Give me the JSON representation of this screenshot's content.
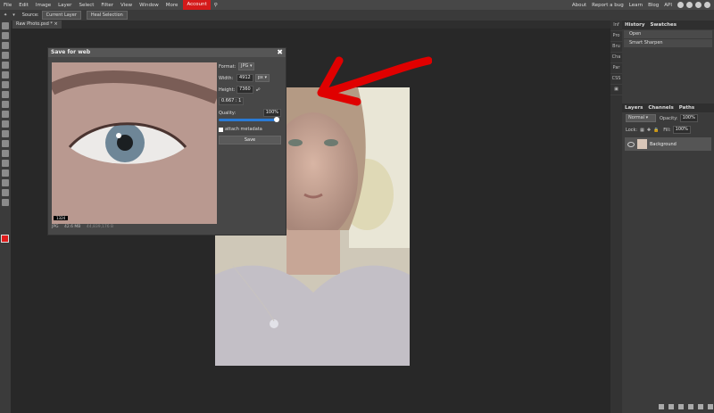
{
  "menubar": {
    "items": [
      "File",
      "Edit",
      "Image",
      "Layer",
      "Select",
      "Filter",
      "View",
      "Window",
      "More"
    ],
    "accent_item": "Account",
    "right_items": [
      "About",
      "Report a bug",
      "Learn",
      "Blog",
      "API"
    ],
    "accent_color": "#d41a1a"
  },
  "options_bar": {
    "source_label": "Source:",
    "source_value": "Current Layer",
    "heal_button": "Heal Selection"
  },
  "tab": {
    "label": "Raw Photo.psd *"
  },
  "dialog": {
    "title": "Save for web",
    "format_label": "Format:",
    "format_value": "JPG",
    "width_label": "Width:",
    "width_value": "4912",
    "unit_value": "px",
    "height_label": "Height:",
    "height_value": "7360",
    "ratio_value": "0.667 : 1",
    "quality_label": "Quality:",
    "quality_value": "100%",
    "quality_level": 1.0,
    "metadata_label": "attach metadata",
    "save_button": "Save",
    "zoom_badge": "1324",
    "footer_format": "JPG",
    "footer_size": "42.6 MB",
    "footer_extra": "44,839,176 B"
  },
  "right_column": {
    "items": [
      "Inf",
      "Pro",
      "Bru",
      "Cha",
      "Par",
      "CSS"
    ]
  },
  "history_panel": {
    "tabs": [
      "History",
      "Swatches"
    ],
    "items": [
      "Open",
      "Smart Sharpen"
    ]
  },
  "layers_panel": {
    "tabs": [
      "Layers",
      "Channels",
      "Paths"
    ],
    "blend_mode": "Normal",
    "opacity_label": "Opacity:",
    "opacity_value": "100%",
    "lock_label": "Lock:",
    "fill_label": "Fill:",
    "fill_value": "100%",
    "layer_name": "Background"
  }
}
